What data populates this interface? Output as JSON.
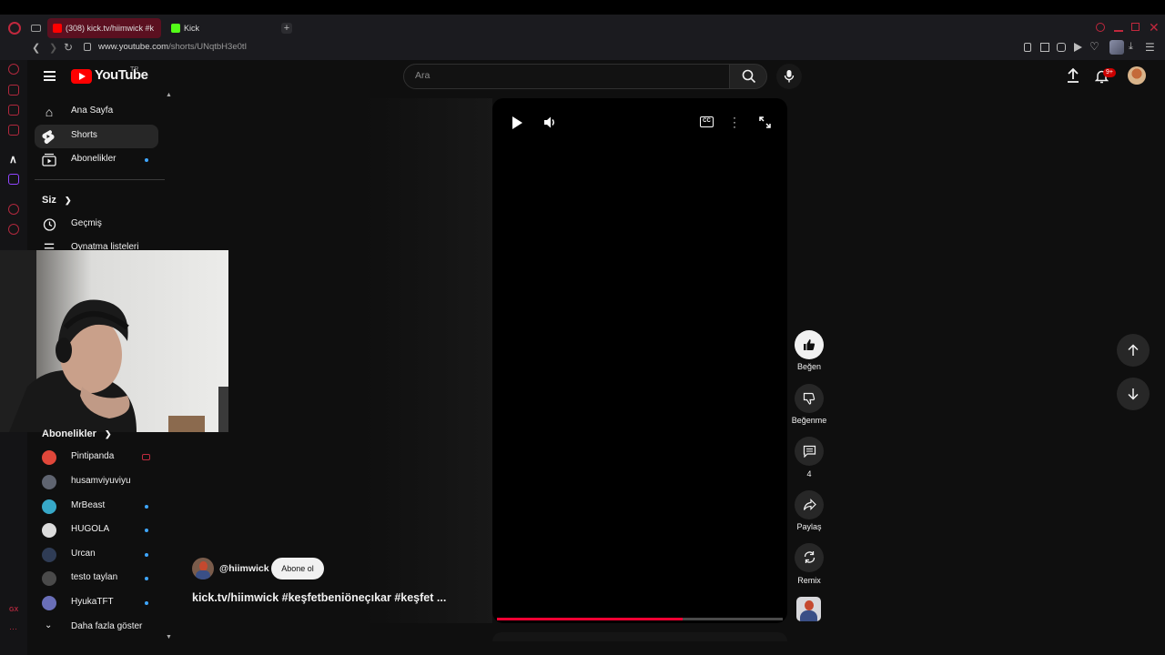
{
  "browser": {
    "tabs": [
      {
        "label": "(308) kick.tv/hiimwick #k",
        "active": true,
        "favicon": "youtube-icon"
      },
      {
        "label": "Kick",
        "active": false,
        "favicon": "kick-icon"
      }
    ],
    "url_host": "www.youtube.com",
    "url_path": "/shorts/UNqtbH3e0tI",
    "notification_badge": "9+"
  },
  "youtube": {
    "logo_text": "YouTube",
    "country_code": "TR",
    "search_placeholder": "Ara",
    "notification_badge": "9+"
  },
  "sidebar": {
    "main": [
      {
        "label": "Ana Sayfa",
        "icon": "home-icon"
      },
      {
        "label": "Shorts",
        "icon": "shorts-icon",
        "selected": true
      },
      {
        "label": "Abonelikler",
        "icon": "subscriptions-icon",
        "dot": true
      }
    ],
    "you_header": "Siz",
    "you": [
      {
        "label": "Geçmiş",
        "icon": "history-icon"
      },
      {
        "label": "Oynatma listeleri",
        "icon": "playlist-icon"
      }
    ],
    "subs_header": "Abonelikler",
    "subscriptions": [
      {
        "label": "Pintipanda",
        "live": true,
        "color": "#e0473a"
      },
      {
        "label": "husamviyuviyu",
        "dot": false,
        "color": "#5f6470"
      },
      {
        "label": "MrBeast",
        "dot": true,
        "color": "#37a8c8"
      },
      {
        "label": "HUGOLA",
        "dot": true,
        "color": "#dcdcdc"
      },
      {
        "label": "Urcan",
        "dot": true,
        "color": "#2f3c55"
      },
      {
        "label": "testo taylan",
        "dot": true,
        "color": "#4a4a4a"
      },
      {
        "label": "HyukaTFT",
        "dot": true,
        "color": "#6a6fb8"
      }
    ],
    "show_more": "Daha fazla göster"
  },
  "short": {
    "channel": "@hiimwick",
    "subscribe_label": "Abone ol",
    "title": "kick.tv/hiimwick  #keşfetbeniöneçıkar #keşfet ...",
    "progress": 0.65,
    "actions": {
      "like": "Beğen",
      "dislike": "Beğenme",
      "comments": "4",
      "share": "Paylaş",
      "remix": "Remix"
    }
  },
  "colors": {
    "accent": "#ff0033",
    "background": "#0f0f0f",
    "opera_red": "#b0283d",
    "link_dot": "#3ea6ff"
  }
}
